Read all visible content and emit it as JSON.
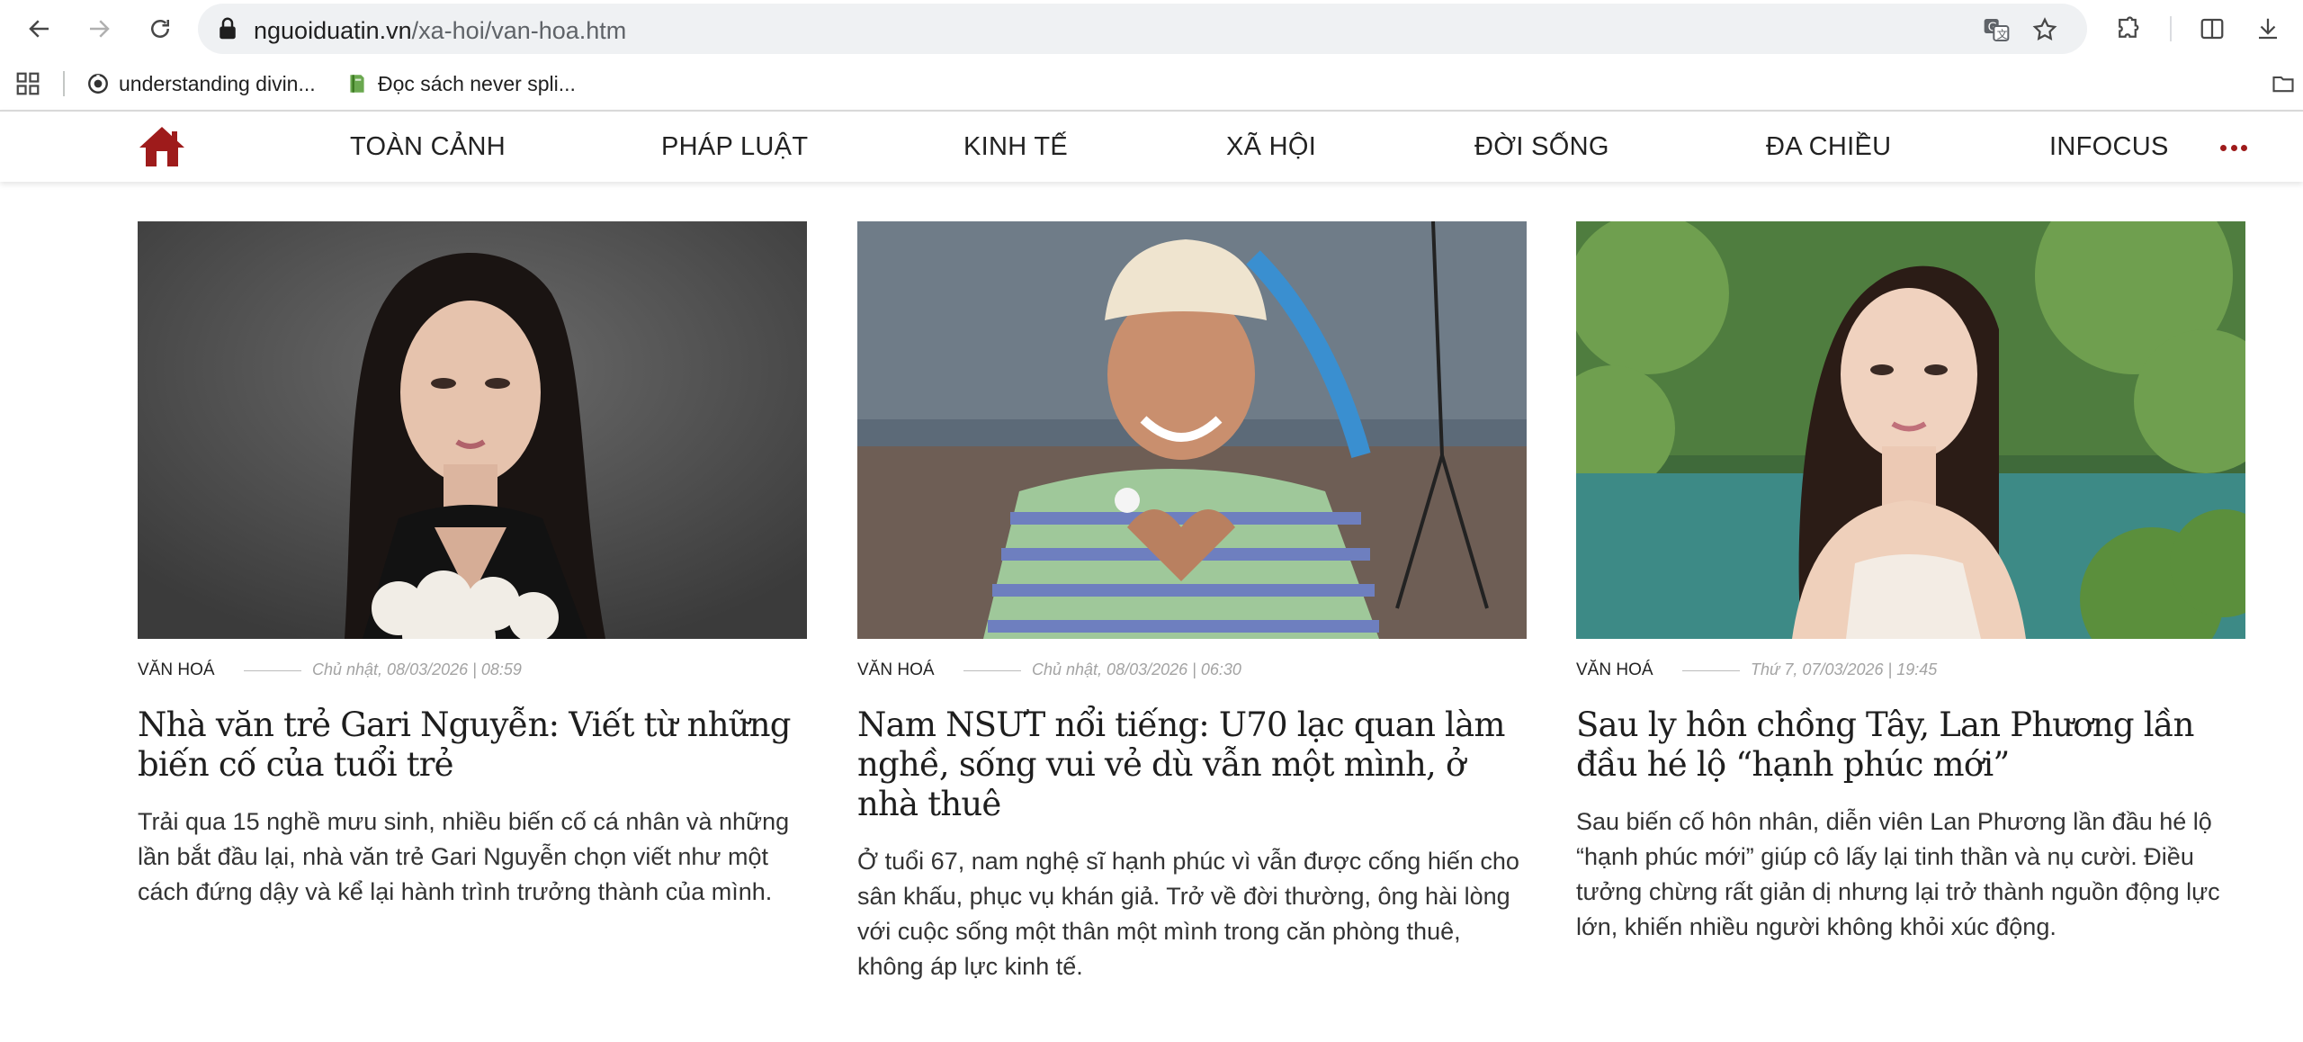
{
  "browser": {
    "url_host": "nguoiduatin.vn",
    "url_path": "/xa-hoi/van-hoa.htm",
    "bookmarks": [
      {
        "label": "understanding divin...",
        "icon": "target-icon"
      },
      {
        "label": "Đọc sách never spli...",
        "icon": "book-icon"
      }
    ]
  },
  "site_nav": {
    "home_icon": "home-icon",
    "accent_color": "#9e1b1b",
    "items": [
      "TOÀN CẢNH",
      "PHÁP LUẬT",
      "KINH TẾ",
      "XÃ HỘI",
      "ĐỜI SỐNG",
      "ĐA CHIỀU",
      "INFOCUS"
    ]
  },
  "articles": [
    {
      "category": "VĂN HOÁ",
      "date": "Chủ nhật, 08/03/2026 | 08:59",
      "title": "Nhà văn trẻ Gari Nguyễn: Viết từ những biến cố của tuổi trẻ",
      "summary": "Trải qua 15 nghề mưu sinh, nhiều biến cố cá nhân và những lần bắt đầu lại, nhà văn trẻ Gari Nguyễn chọn viết như một cách đứng dậy và kể lại hành trình trưởng thành của mình."
    },
    {
      "category": "VĂN HOÁ",
      "date": "Chủ nhật, 08/03/2026 | 06:30",
      "title": "Nam NSƯT nổi tiếng: U70 lạc quan làm nghề, sống vui vẻ dù vẫn một mình, ở nhà thuê",
      "summary": "Ở tuổi 67, nam nghệ sĩ hạnh phúc vì vẫn được cống hiến cho sân khấu, phục vụ khán giả. Trở về đời thường, ông hài lòng với cuộc sống một thân một mình trong căn phòng thuê, không áp lực kinh tế."
    },
    {
      "category": "VĂN HOÁ",
      "date": "Thứ 7, 07/03/2026 | 19:45",
      "title": "Sau ly hôn chồng Tây, Lan Phương lần đầu hé lộ “hạnh phúc mới”",
      "summary": "Sau biến cố hôn nhân, diễn viên Lan Phương lần đầu hé lộ “hạnh phúc mới” giúp cô lấy lại tinh thần và nụ cười. Điều tưởng chừng rất giản dị nhưng lại trở thành nguồn động lực lớn, khiến nhiều người không khỏi xúc động."
    }
  ]
}
